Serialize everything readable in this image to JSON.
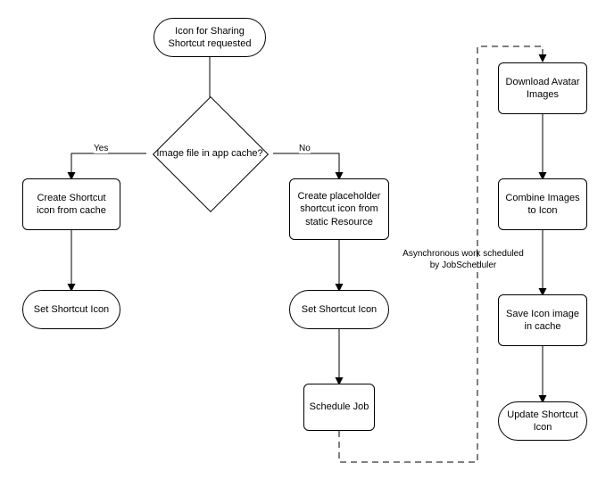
{
  "flow": {
    "start": "Icon for Sharing Shortcut requested",
    "decision": "Image file in app cache?",
    "yesLabel": "Yes",
    "noLabel": "No",
    "leftPath": {
      "createFromCache": "Create Shortcut icon from cache",
      "setIconLeft": "Set Shortcut Icon"
    },
    "middlePath": {
      "createPlaceholder": "Create placeholder shortcut icon from static Resource",
      "setIconMid": "Set Shortcut Icon",
      "scheduleJob": "Schedule Job"
    },
    "rightPath": {
      "downloadAvatar": "Download Avatar Images",
      "combineImages": "Combine Images to Icon",
      "saveIcon": "Save Icon image in cache",
      "updateIcon": "Update Shortcut Icon"
    },
    "asyncNote": "Asynchronous work scheduled by JobScheduler"
  }
}
